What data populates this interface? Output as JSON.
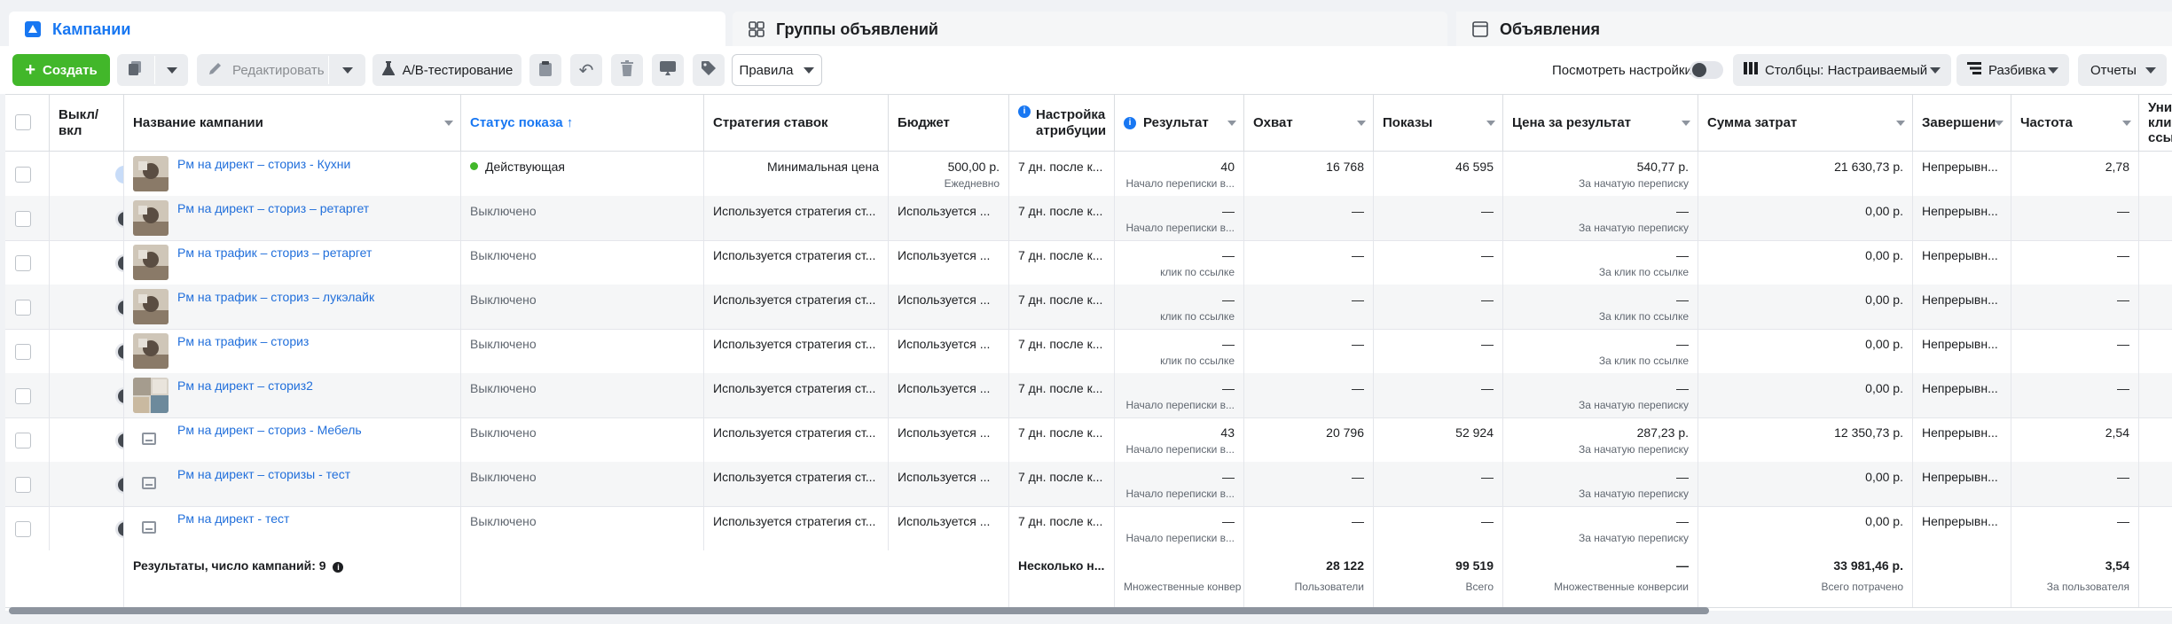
{
  "tabs": {
    "campaigns": "Кампании",
    "adsets": "Группы объявлений",
    "ads": "Объявления"
  },
  "toolbar": {
    "create": "Создать",
    "edit": "Редактировать",
    "ab_test": "A/B-тестирование",
    "rules": "Правила",
    "view_settings": "Посмотреть настройки",
    "columns": "Столбцы: Настраиваемый",
    "breakdown": "Разбивка",
    "reports": "Отчеты"
  },
  "headers": {
    "toggle": "Выкл/\nвкл",
    "name": "Название кампании",
    "status": "Статус показа ↑",
    "bid": "Стратегия ставок",
    "budget": "Бюджет",
    "attribution": "Настройка\nатрибуции",
    "result": "Результат",
    "reach": "Охват",
    "impressions": "Показы",
    "cpr": "Цена за результат",
    "spent": "Сумма затрат",
    "ends": "Завершени",
    "frequency": "Частота",
    "unique": "Уни\nкли\nссы"
  },
  "rows": [
    {
      "name": "Рм на директ – сториз - Кухни",
      "on": true,
      "status": "Действующая",
      "active": true,
      "bid": "Минимальная цена",
      "budget": "500,00 р.",
      "budget_sub": "Ежедневно",
      "attr": "7 дн. после к...",
      "result": "40",
      "result_sub": "Начало переписки в...",
      "reach": "16 768",
      "impr": "46 595",
      "cpr": "540,77 р.",
      "cpr_sub": "За начатую переписку",
      "spent": "21 630,73 р.",
      "ends": "Непрерывн...",
      "freq": "2,78",
      "thumb": "img"
    },
    {
      "name": "Рм на директ – сториз – ретаргет",
      "on": false,
      "status": "Выключено",
      "active": false,
      "bid": "Используется стратегия ст...",
      "budget": "Используется ...",
      "budget_sub": "",
      "attr": "7 дн. после к...",
      "result": "—",
      "result_sub": "Начало переписки в...",
      "reach": "—",
      "impr": "—",
      "cpr": "—",
      "cpr_sub": "За начатую переписку",
      "spent": "0,00 р.",
      "ends": "Непрерывн...",
      "freq": "—",
      "thumb": "img"
    },
    {
      "name": "Рм на трафик – сториз – ретаргет",
      "on": false,
      "status": "Выключено",
      "active": false,
      "bid": "Используется стратегия ст...",
      "budget": "Используется ...",
      "budget_sub": "",
      "attr": "7 дн. после к...",
      "result": "—",
      "result_sub": "клик по ссылке",
      "reach": "—",
      "impr": "—",
      "cpr": "—",
      "cpr_sub": "За клик по ссылке",
      "spent": "0,00 р.",
      "ends": "Непрерывн...",
      "freq": "—",
      "thumb": "img"
    },
    {
      "name": "Рм на трафик – сториз – лукэлайк",
      "on": false,
      "status": "Выключено",
      "active": false,
      "bid": "Используется стратегия ст...",
      "budget": "Используется ...",
      "budget_sub": "",
      "attr": "7 дн. после к...",
      "result": "—",
      "result_sub": "клик по ссылке",
      "reach": "—",
      "impr": "—",
      "cpr": "—",
      "cpr_sub": "За клик по ссылке",
      "spent": "0,00 р.",
      "ends": "Непрерывн...",
      "freq": "—",
      "thumb": "img"
    },
    {
      "name": "Рм на трафик – сториз",
      "on": false,
      "status": "Выключено",
      "active": false,
      "bid": "Используется стратегия ст...",
      "budget": "Используется ...",
      "budget_sub": "",
      "attr": "7 дн. после к...",
      "result": "—",
      "result_sub": "клик по ссылке",
      "reach": "—",
      "impr": "—",
      "cpr": "—",
      "cpr_sub": "За клик по ссылке",
      "spent": "0,00 р.",
      "ends": "Непрерывн...",
      "freq": "—",
      "thumb": "img"
    },
    {
      "name": "Рм на директ – сториз2",
      "on": false,
      "status": "Выключено",
      "active": false,
      "bid": "Используется стратегия ст...",
      "budget": "Используется ...",
      "budget_sub": "",
      "attr": "7 дн. после к...",
      "result": "—",
      "result_sub": "Начало переписки в...",
      "reach": "—",
      "impr": "—",
      "cpr": "—",
      "cpr_sub": "За начатую переписку",
      "spent": "0,00 р.",
      "ends": "Непрерывн...",
      "freq": "—",
      "thumb": "img2"
    },
    {
      "name": "Рм на директ – сториз - Мебель",
      "on": false,
      "status": "Выключено",
      "active": false,
      "bid": "Используется стратегия ст...",
      "budget": "Используется ...",
      "budget_sub": "",
      "attr": "7 дн. после к...",
      "result": "43",
      "result_sub": "Начало переписки в...",
      "reach": "20 796",
      "impr": "52 924",
      "cpr": "287,23 р.",
      "cpr_sub": "За начатую переписку",
      "spent": "12 350,73 р.",
      "ends": "Непрерывн...",
      "freq": "2,54",
      "thumb": "ph"
    },
    {
      "name": "Рм на директ – сторизы - тест",
      "on": false,
      "status": "Выключено",
      "active": false,
      "bid": "Используется стратегия ст...",
      "budget": "Используется ...",
      "budget_sub": "",
      "attr": "7 дн. после к...",
      "result": "—",
      "result_sub": "Начало переписки в...",
      "reach": "—",
      "impr": "—",
      "cpr": "—",
      "cpr_sub": "За начатую переписку",
      "spent": "0,00 р.",
      "ends": "Непрерывн...",
      "freq": "—",
      "thumb": "ph"
    },
    {
      "name": "Рм на директ - тест",
      "on": false,
      "status": "Выключено",
      "active": false,
      "bid": "Используется стратегия ст...",
      "budget": "Используется ...",
      "budget_sub": "",
      "attr": "7 дн. после к...",
      "result": "—",
      "result_sub": "Начало переписки в...",
      "reach": "—",
      "impr": "—",
      "cpr": "—",
      "cpr_sub": "За начатую переписку",
      "spent": "0,00 р.",
      "ends": "Непрерывн...",
      "freq": "—",
      "thumb": "ph"
    }
  ],
  "footer": {
    "label": "Результаты, число кампаний: 9",
    "attr": "Несколько н...",
    "result_sub": "Множественные конвер",
    "reach": "28 122",
    "reach_sub": "Пользователи",
    "impr": "99 519",
    "impr_sub": "Всего",
    "cpr": "—",
    "cpr_sub": "Множественные конверсии",
    "spent": "33 981,46 р.",
    "spent_sub": "Всего потрачено",
    "freq": "3,54",
    "freq_sub": "За пользователя"
  },
  "colors": {
    "accent": "#1877f2",
    "link": "#216fdb",
    "green": "#42b72a"
  }
}
